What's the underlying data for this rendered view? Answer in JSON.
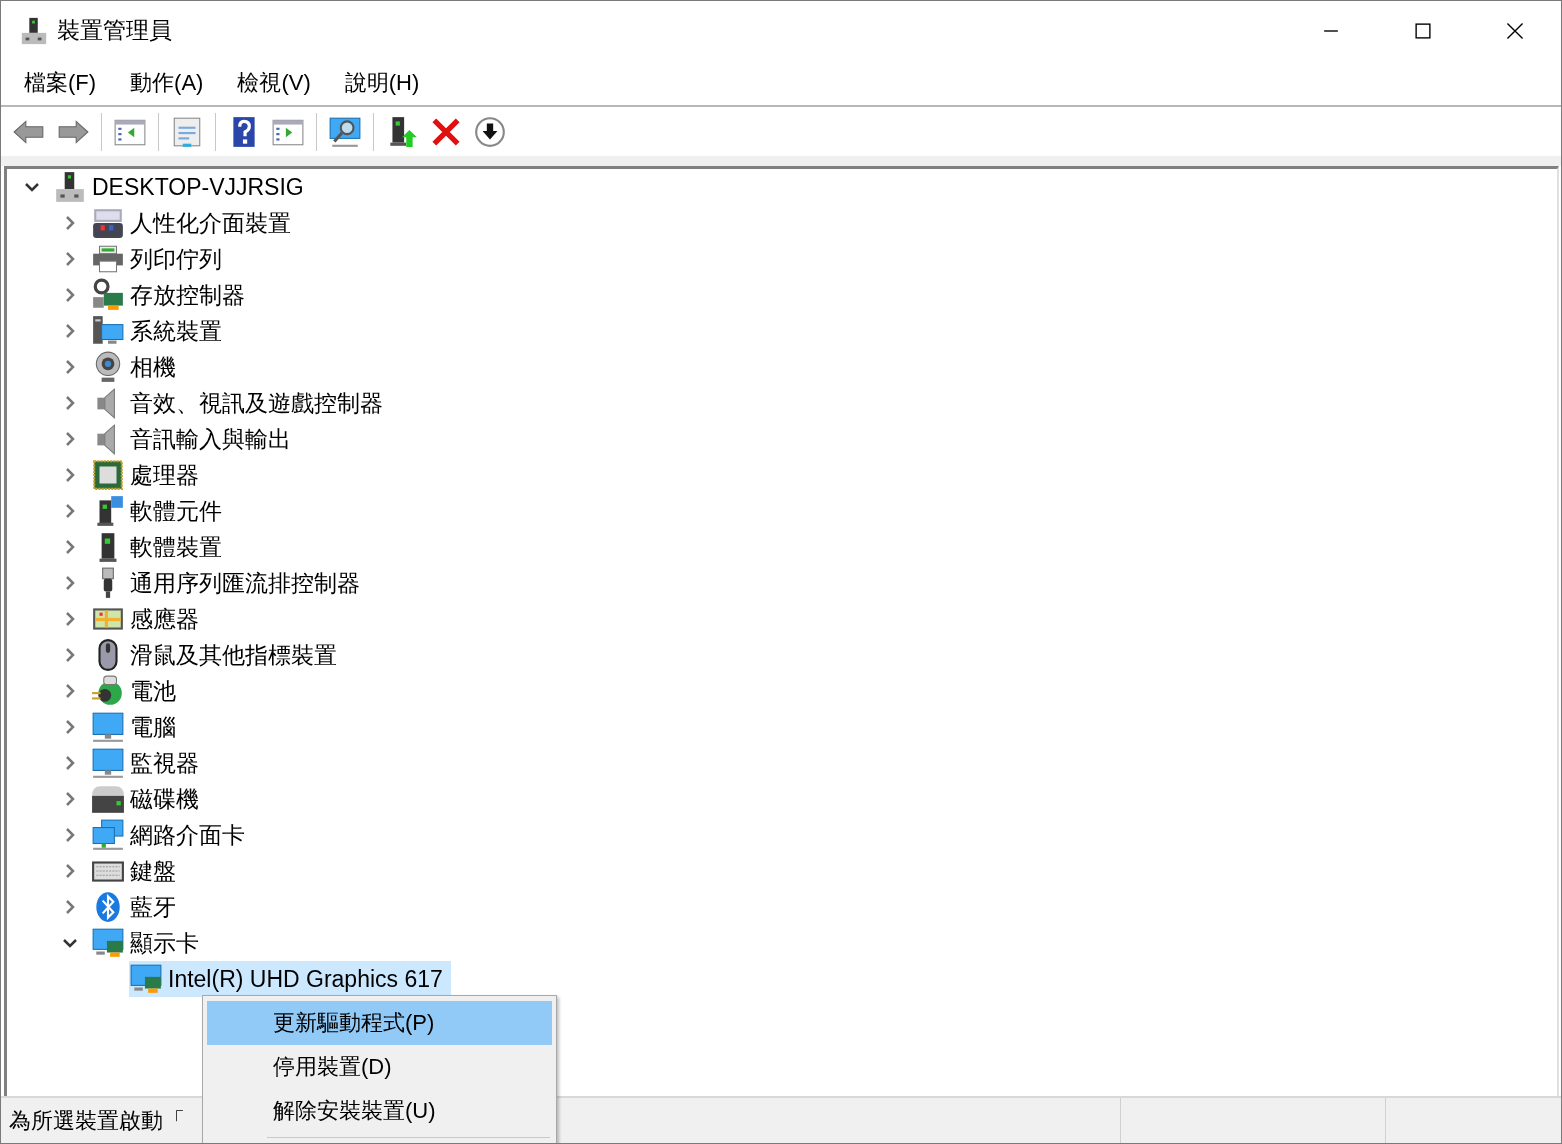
{
  "window": {
    "title": "裝置管理員"
  },
  "menu_bar": [
    {
      "label": "檔案(F)"
    },
    {
      "label": "動作(A)"
    },
    {
      "label": "檢視(V)"
    },
    {
      "label": "說明(H)"
    }
  ],
  "tree": {
    "label": "DESKTOP-VJJRSIG",
    "expanded": true,
    "selected": false,
    "children": [
      {
        "label": "人性化介面裝置",
        "expanded": false,
        "selected": false
      },
      {
        "label": "列印佇列",
        "expanded": false,
        "selected": false
      },
      {
        "label": "存放控制器",
        "expanded": false,
        "selected": false
      },
      {
        "label": "系統裝置",
        "expanded": false,
        "selected": false
      },
      {
        "label": "相機",
        "expanded": false,
        "selected": false
      },
      {
        "label": "音效、視訊及遊戲控制器",
        "expanded": false,
        "selected": false
      },
      {
        "label": "音訊輸入與輸出",
        "expanded": false,
        "selected": false
      },
      {
        "label": "處理器",
        "expanded": false,
        "selected": false
      },
      {
        "label": "軟體元件",
        "expanded": false,
        "selected": false
      },
      {
        "label": "軟體裝置",
        "expanded": false,
        "selected": false
      },
      {
        "label": "通用序列匯流排控制器",
        "expanded": false,
        "selected": false
      },
      {
        "label": "感應器",
        "expanded": false,
        "selected": false
      },
      {
        "label": "滑鼠及其他指標裝置",
        "expanded": false,
        "selected": false
      },
      {
        "label": "電池",
        "expanded": false,
        "selected": false
      },
      {
        "label": "電腦",
        "expanded": false,
        "selected": false
      },
      {
        "label": "監視器",
        "expanded": false,
        "selected": false
      },
      {
        "label": "磁碟機",
        "expanded": false,
        "selected": false
      },
      {
        "label": "網路介面卡",
        "expanded": false,
        "selected": false
      },
      {
        "label": "鍵盤",
        "expanded": false,
        "selected": false
      },
      {
        "label": "藍牙",
        "expanded": false,
        "selected": false
      },
      {
        "label": "顯示卡",
        "expanded": true,
        "selected": false,
        "children": [
          {
            "label": "Intel(R) UHD Graphics 617",
            "selected": true
          }
        ]
      }
    ]
  },
  "context_menu": {
    "items": [
      {
        "label": "更新驅動程式(P)",
        "selected": true
      },
      {
        "label": "停用裝置(D)",
        "selected": false
      },
      {
        "label": "解除安裝裝置(U)",
        "selected": false
      }
    ]
  },
  "status_bar": {
    "text": "為所選裝置啟動「"
  }
}
